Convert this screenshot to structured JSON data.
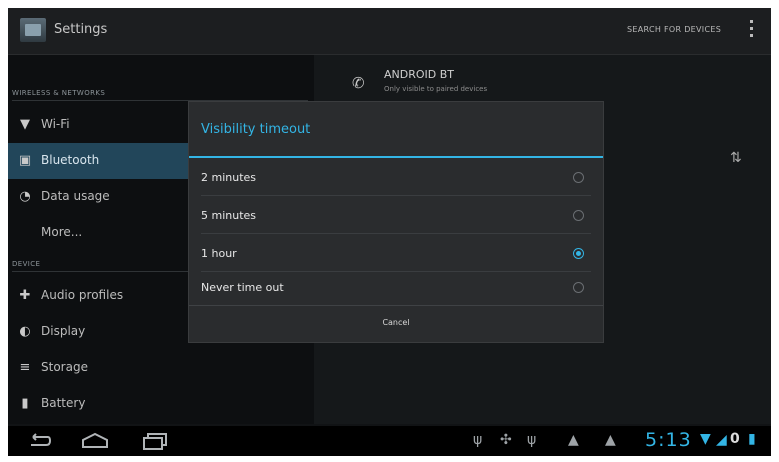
{
  "app": {
    "title": "Settings"
  },
  "actionbar": {
    "search_label": "SEARCH FOR DEVICES"
  },
  "sidebar": {
    "sections": [
      {
        "header": "WIRELESS & NETWORKS"
      },
      {
        "header": "DEVICE"
      }
    ],
    "items": [
      {
        "label": "Wi-Fi",
        "icon": "wifi-icon"
      },
      {
        "label": "Bluetooth",
        "icon": "bluetooth-icon",
        "selected": true
      },
      {
        "label": "Data usage",
        "icon": "data-usage-icon"
      },
      {
        "label": "More...",
        "icon": ""
      },
      {
        "label": "Audio profiles",
        "icon": "audio-profiles-icon"
      },
      {
        "label": "Display",
        "icon": "display-icon"
      },
      {
        "label": "Storage",
        "icon": "storage-icon"
      },
      {
        "label": "Battery",
        "icon": "battery-icon"
      }
    ]
  },
  "device": {
    "name": "ANDROID BT",
    "subtitle": "Only visible to paired devices"
  },
  "dialog": {
    "title": "Visibility timeout",
    "options": [
      {
        "label": "2 minutes",
        "checked": false
      },
      {
        "label": "5 minutes",
        "checked": false
      },
      {
        "label": "1 hour",
        "checked": true
      },
      {
        "label": "Never time out",
        "checked": false
      }
    ],
    "cancel_label": "Cancel"
  },
  "statusbar": {
    "time": "5:13"
  },
  "colors": {
    "accent": "#33b5e5",
    "selected_row": "#22465a"
  }
}
